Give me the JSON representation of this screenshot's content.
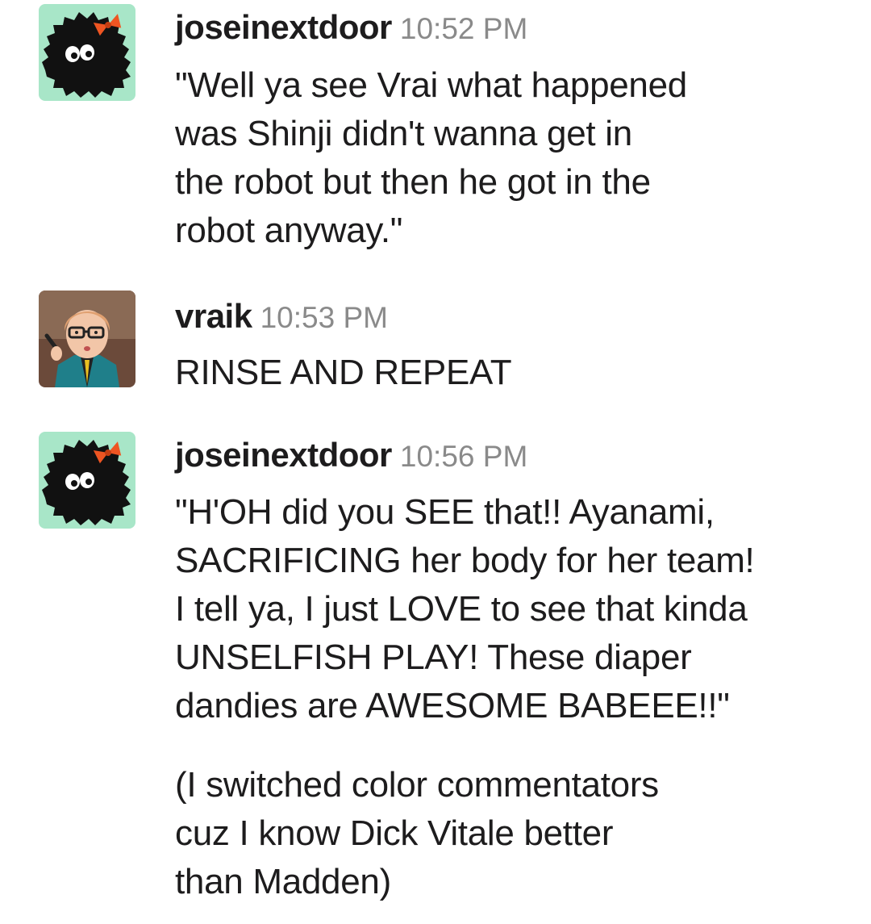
{
  "messages": [
    {
      "username": "joseinextdoor",
      "timestamp": "10:52 PM",
      "avatar_icon": "soot-sprite-with-bow-icon",
      "paragraphs": [
        "\"Well ya see Vrai what happened\nwas Shinji didn't wanna get in\nthe robot but then he got in the\nrobot anyway.\""
      ]
    },
    {
      "username": "vraik",
      "timestamp": "10:53 PM",
      "avatar_icon": "illustrated-person-with-glasses-icon",
      "paragraphs": [
        "RINSE AND REPEAT"
      ]
    },
    {
      "username": "joseinextdoor",
      "timestamp": "10:56 PM",
      "avatar_icon": "soot-sprite-with-bow-icon",
      "paragraphs": [
        "\"H'OH did you SEE that!! Ayanami,\nSACRIFICING her body for her team!\nI tell ya, I just LOVE to see that kinda\nUNSELFISH PLAY! These diaper\ndandies are AWESOME BABEEE!!\"",
        "(I switched color commentators\ncuz I know Dick Vitale better\nthan Madden)"
      ]
    }
  ],
  "colors": {
    "avatar_bg_mint": "#a8e6c8",
    "timestamp_gray": "#8a8a8a",
    "text": "#1d1c1d",
    "bow_orange": "#ee5522"
  }
}
